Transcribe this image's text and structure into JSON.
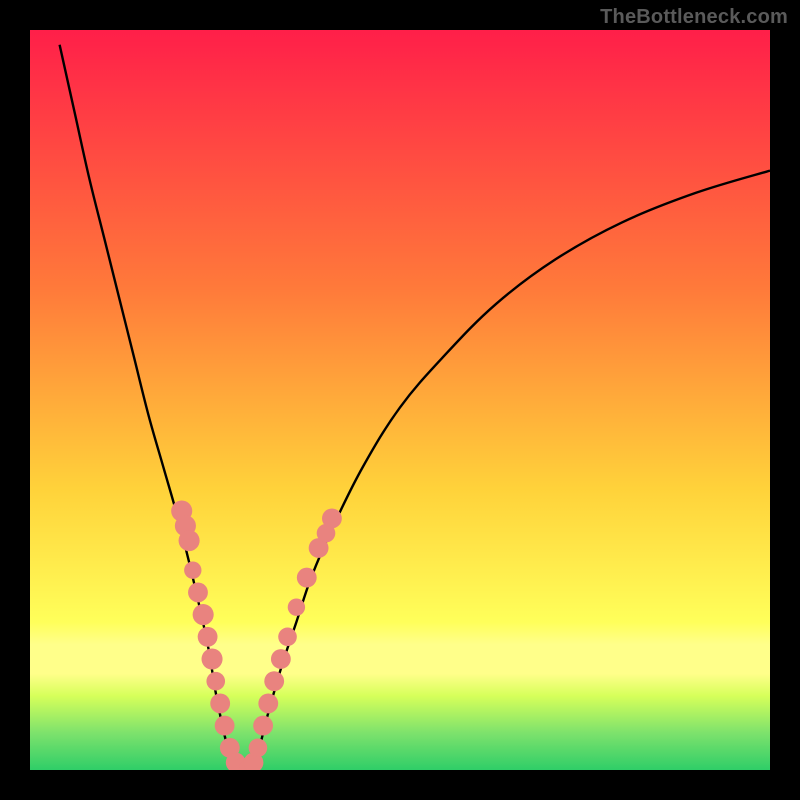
{
  "watermark": "TheBottleneck.com",
  "colors": {
    "top": "#ff1f49",
    "mid1": "#ff7a3a",
    "mid2": "#ffd23a",
    "band": "#ffff8a",
    "green1": "#b6ff4d",
    "green2": "#36d86c",
    "marker": "#e9837f",
    "curve": "#000000"
  },
  "chart_data": {
    "type": "line",
    "title": "",
    "xlabel": "",
    "ylabel": "",
    "x_range": [
      0,
      100
    ],
    "y_range": [
      0,
      100
    ],
    "series": [
      {
        "name": "left-curve",
        "x": [
          4,
          6,
          8,
          10,
          12,
          14,
          16,
          18,
          20,
          22,
          24,
          25,
          26,
          27,
          28
        ],
        "y": [
          98,
          89,
          80,
          72,
          64,
          56,
          48,
          41,
          34,
          26,
          17,
          11,
          6,
          2,
          0
        ]
      },
      {
        "name": "right-curve",
        "x": [
          30,
          31,
          32,
          34,
          36,
          38,
          41,
          45,
          50,
          56,
          63,
          71,
          80,
          90,
          100
        ],
        "y": [
          0,
          3,
          7,
          14,
          20,
          26,
          33,
          41,
          49,
          56,
          63,
          69,
          74,
          78,
          81
        ]
      }
    ],
    "markers_left": [
      {
        "x": 20.5,
        "y": 35,
        "r": 1.7
      },
      {
        "x": 21.0,
        "y": 33,
        "r": 1.7
      },
      {
        "x": 21.5,
        "y": 31,
        "r": 1.7
      },
      {
        "x": 22.0,
        "y": 27,
        "r": 1.4
      },
      {
        "x": 22.7,
        "y": 24,
        "r": 1.6
      },
      {
        "x": 23.4,
        "y": 21,
        "r": 1.7
      },
      {
        "x": 24.0,
        "y": 18,
        "r": 1.6
      },
      {
        "x": 24.6,
        "y": 15,
        "r": 1.7
      },
      {
        "x": 25.1,
        "y": 12,
        "r": 1.5
      },
      {
        "x": 25.7,
        "y": 9,
        "r": 1.6
      },
      {
        "x": 26.3,
        "y": 6,
        "r": 1.6
      },
      {
        "x": 27.0,
        "y": 3,
        "r": 1.6
      },
      {
        "x": 27.8,
        "y": 1,
        "r": 1.6
      }
    ],
    "markers_bottom": [
      {
        "x": 28.5,
        "y": 0.2,
        "r": 1.6
      },
      {
        "x": 29.5,
        "y": 0.2,
        "r": 1.5
      }
    ],
    "markers_right": [
      {
        "x": 30.2,
        "y": 1,
        "r": 1.6
      },
      {
        "x": 30.8,
        "y": 3,
        "r": 1.5
      },
      {
        "x": 31.5,
        "y": 6,
        "r": 1.6
      },
      {
        "x": 32.2,
        "y": 9,
        "r": 1.6
      },
      {
        "x": 33.0,
        "y": 12,
        "r": 1.6
      },
      {
        "x": 33.9,
        "y": 15,
        "r": 1.6
      },
      {
        "x": 34.8,
        "y": 18,
        "r": 1.5
      },
      {
        "x": 36.0,
        "y": 22,
        "r": 1.4
      },
      {
        "x": 37.4,
        "y": 26,
        "r": 1.6
      },
      {
        "x": 39.0,
        "y": 30,
        "r": 1.6
      },
      {
        "x": 40.0,
        "y": 32,
        "r": 1.5
      },
      {
        "x": 40.8,
        "y": 34,
        "r": 1.6
      }
    ],
    "gradient_stops": [
      {
        "pos": 0.0,
        "color": "#ff1f49"
      },
      {
        "pos": 0.35,
        "color": "#ff7a3a"
      },
      {
        "pos": 0.62,
        "color": "#ffd23a"
      },
      {
        "pos": 0.8,
        "color": "#ffff5a"
      },
      {
        "pos": 0.83,
        "color": "#ffff8a"
      },
      {
        "pos": 0.87,
        "color": "#ffff8a"
      },
      {
        "pos": 0.9,
        "color": "#d6ff5a"
      },
      {
        "pos": 0.95,
        "color": "#7de26c"
      },
      {
        "pos": 1.0,
        "color": "#2fce68"
      }
    ]
  }
}
